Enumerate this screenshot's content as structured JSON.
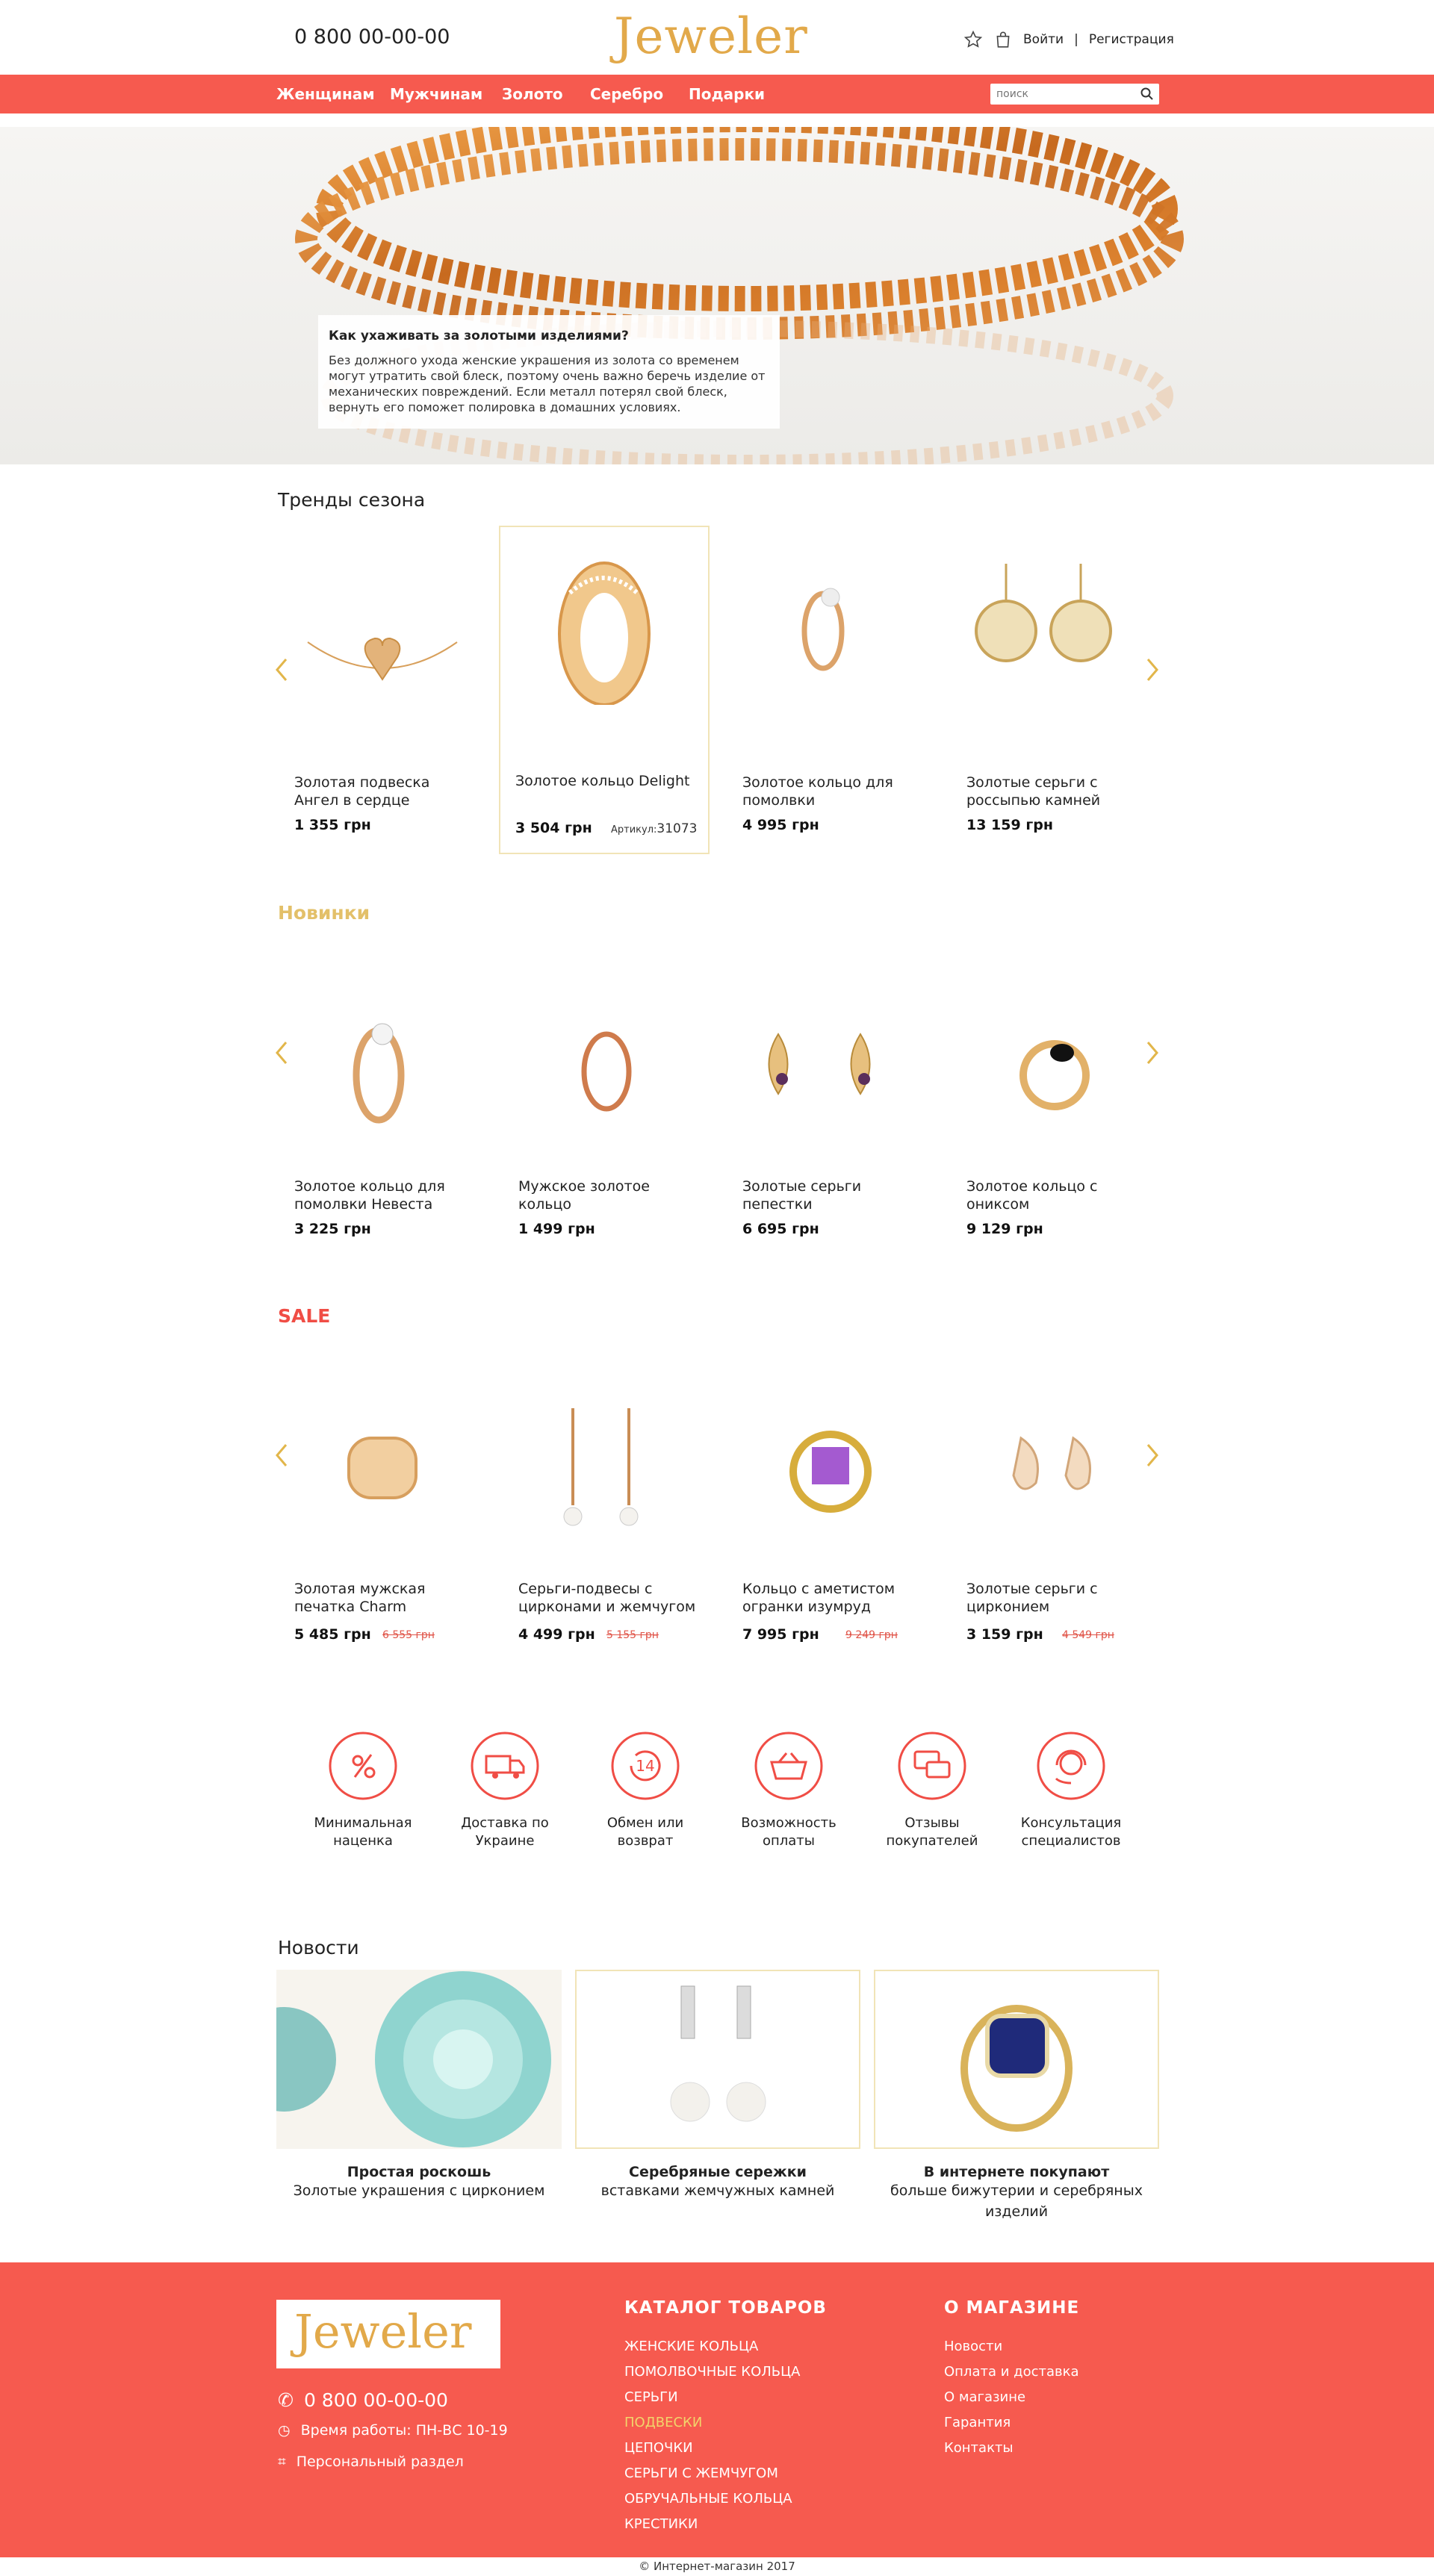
{
  "header": {
    "phone": "0 800 00-00-00",
    "logo": "Jeweler",
    "login": "Войти",
    "separator": "|",
    "register": "Регистрация"
  },
  "nav": {
    "items": [
      "Женщинам",
      "Мужчинам",
      "Золото",
      "Серебро",
      "Подарки"
    ],
    "search_placeholder": "поиск"
  },
  "hero": {
    "title": "Как ухаживать за золотыми изделиями?",
    "text": "Без должного ухода женские украшения из золота со временем могут утратить свой блеск, поэтому очень важно беречь изделие от механических повреждений. Если металл потерял свой блеск, вернуть его поможет полировка в домашних условиях."
  },
  "trends": {
    "title": "Тренды сезона",
    "items": [
      {
        "name": "Золотая подвеска Ангел в сердце",
        "price": "1 355 грн"
      },
      {
        "name": "Золотое кольцо Delight",
        "price": "3 504 грн",
        "article_label": "Артикул:",
        "article": "31073"
      },
      {
        "name": "Золотое кольцо для помолвки",
        "price": "4 995 грн"
      },
      {
        "name": "Золотые серьги с россыпью камней",
        "price": "13 159 грн"
      }
    ]
  },
  "new": {
    "title": "Новинки",
    "items": [
      {
        "name": "Золотое кольцо для помолвки Невеста",
        "price": "3 225 грн"
      },
      {
        "name": "Мужское золотое кольцо",
        "price": "1 499 грн"
      },
      {
        "name": "Золотые серьги пепестки",
        "price": "6 695 грн"
      },
      {
        "name": "Золотое кольцо с ониксом",
        "price": "9 129 грн"
      }
    ]
  },
  "sale": {
    "title": "SALE",
    "items": [
      {
        "name": "Золотая мужская печатка Charm",
        "price": "5 485 грн",
        "old": "6 555 грн"
      },
      {
        "name": "Серьги-подвесы с цирконами и жемчугом",
        "price": "4 499 грн",
        "old": "5 155 грн"
      },
      {
        "name": "Кольцо с аметистом огранки изумруд",
        "price": "7 995 грн",
        "old": "9 249 грн"
      },
      {
        "name": "Золотые серьги с цирконием",
        "price": "3 159 грн",
        "old": "4 549 грн"
      }
    ]
  },
  "features": [
    {
      "icon": "percent-icon",
      "label": "Минимальная наценка"
    },
    {
      "icon": "truck-icon",
      "label": "Доставка по Украине"
    },
    {
      "icon": "return-14-icon",
      "label": "Обмен или возврат"
    },
    {
      "icon": "basket-icon",
      "label": "Возможность оплаты"
    },
    {
      "icon": "chat-icon",
      "label": "Отзывы покупателей"
    },
    {
      "icon": "headset-icon",
      "label": "Консультация специалистов"
    }
  ],
  "news": {
    "title": "Новости",
    "items": [
      {
        "title": "Простая роскошь",
        "desc": "Золотые украшения с цирконием"
      },
      {
        "title": "Серебряные сережки",
        "desc": "вставками жемчужных камней"
      },
      {
        "title": "В интернете покупают",
        "desc": "больше бижутерии и серебряных изделий"
      }
    ]
  },
  "footer": {
    "logo": "Jeweler",
    "phone": "0 800 00-00-00",
    "hours": "Время работы: ПН-ВС 10-19",
    "personal": "Персональный раздел",
    "catalog_title": "КАТАЛОГ ТОВАРОВ",
    "catalog": [
      "ЖЕНСКИЕ КОЛЬЦА",
      "ПОМОЛВОЧНЫЕ КОЛЬЦА",
      "СЕРЬГИ",
      "ПОДВЕСКИ",
      "ЦЕПОЧКИ",
      "СЕРЬГИ С ЖЕМЧУГОМ",
      "ОБРУЧАЛЬНЫЕ КОЛЬЦА",
      "КРЕСТИКИ"
    ],
    "about_title": "О МАГАЗИНЕ",
    "about": [
      "Новости",
      "Оплата и доставка",
      "О магазине",
      "Гарантия",
      "Контакты"
    ]
  },
  "copyright": "© Интернет-магазин 2017",
  "colors": {
    "accent": "#f65a4f",
    "gold": "#e2a94a",
    "new_title": "#e3c069",
    "sale_title": "#f04d45"
  }
}
